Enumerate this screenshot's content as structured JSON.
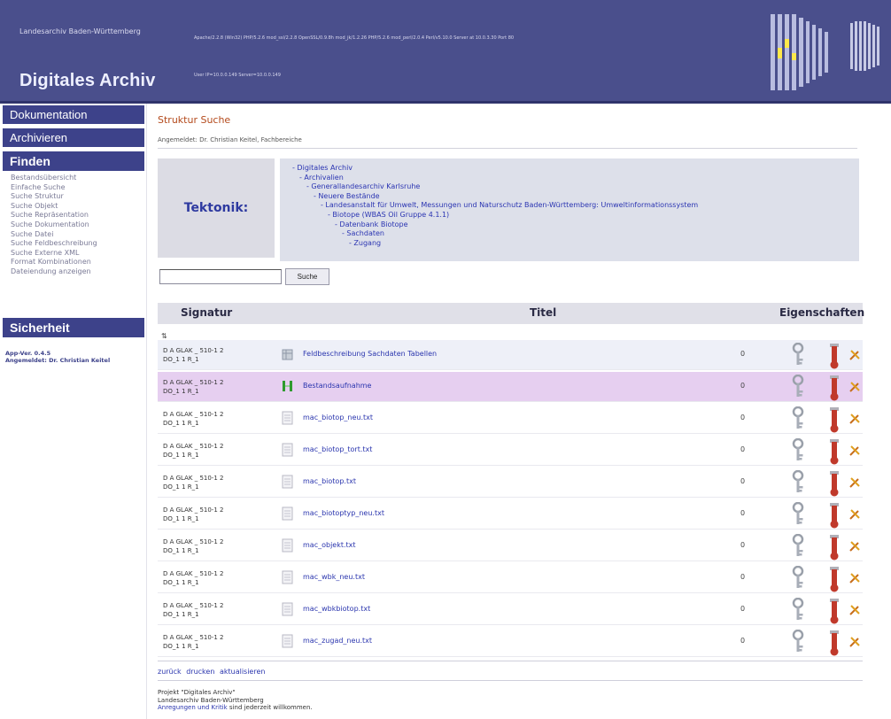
{
  "header": {
    "org_name": "Landesarchiv Baden-Württemberg",
    "app_title": "Digitales Archiv",
    "server_info": "Apache/2.2.8 (Win32) PHP/5.2.6 mod_ssl/2.2.8 OpenSSL/0.9.8h mod_jk/1.2.26 PHP/5.2.6 mod_perl/2.0.4 Perl/v5.10.0 Server at 10.0.3.30 Port 80",
    "server_ip": "User IP=10.0.0.149  Server=10.0.0.149"
  },
  "sidebar": {
    "doc": "Dokumentation",
    "archive": "Archivieren",
    "find": "Finden",
    "sub_items": [
      "Bestandsübersicht",
      "Einfache Suche",
      "Suche Struktur",
      "Suche Objekt",
      "Suche Repräsentation",
      "Suche Dokumentation",
      "Suche Datei",
      "Suche Feldbeschreibung",
      "Suche Externe XML",
      "Format Kombinationen",
      "Dateiendung anzeigen"
    ],
    "security": "Sicherheit",
    "app_version": "App-Ver. 0.4.5",
    "user": "Angemeldet: Dr. Christian Keitel"
  },
  "main": {
    "page_title": "Struktur Suche",
    "logged_user": "Angemeldet: Dr. Christian Keitel, Fachbereiche",
    "tektonik_label": "Tektonik:",
    "tree": [
      "- Digitales Archiv",
      "- Archivalien",
      "- Generallandesarchiv Karlsruhe",
      "- Neuere Bestände",
      "- Landesanstalt für Umwelt, Messungen und Naturschutz Baden-Württemberg: Umweltinformationssystem",
      "- Biotope (WBAS Oil Gruppe 4.1.1)",
      "- Datenbank Biotope",
      "- Sachdaten",
      "- Zugang"
    ],
    "search_value": "",
    "search_button": "Suche"
  },
  "table": {
    "headers": {
      "signature": "Signatur",
      "title": "Titel",
      "properties": "Eigenschaften"
    },
    "sort_symbol": "⇅",
    "rows": [
      {
        "sig1": "D A GLAK _ 510-1 2",
        "sig2": "DO_1 1 R_1",
        "title": "Feldbeschreibung Sachdaten Tabellen",
        "num": "0"
      },
      {
        "sig1": "D A GLAK _ 510-1 2",
        "sig2": "DO_1 1 R_1",
        "title": "Bestandsaufnahme",
        "num": "0"
      },
      {
        "sig1": "D A GLAK _ 510-1 2",
        "sig2": "DO_1 1 R_1",
        "title": "mac_biotop_neu.txt",
        "num": "0"
      },
      {
        "sig1": "D A GLAK _ 510-1 2",
        "sig2": "DO_1 1 R_1",
        "title": "mac_biotop_tort.txt",
        "num": "0"
      },
      {
        "sig1": "D A GLAK _ 510-1 2",
        "sig2": "DO_1 1 R_1",
        "title": "mac_biotop.txt",
        "num": "0"
      },
      {
        "sig1": "D A GLAK _ 510-1 2",
        "sig2": "DO_1 1 R_1",
        "title": "mac_biotoptyp_neu.txt",
        "num": "0"
      },
      {
        "sig1": "D A GLAK _ 510-1 2",
        "sig2": "DO_1 1 R_1",
        "title": "mac_objekt.txt",
        "num": "0"
      },
      {
        "sig1": "D A GLAK _ 510-1 2",
        "sig2": "DO_1 1 R_1",
        "title": "mac_wbk_neu.txt",
        "num": "0"
      },
      {
        "sig1": "D A GLAK _ 510-1 2",
        "sig2": "DO_1 1 R_1",
        "title": "mac_wbkbiotop.txt",
        "num": "0"
      },
      {
        "sig1": "D A GLAK _ 510-1 2",
        "sig2": "DO_1 1 R_1",
        "title": "mac_zugad_neu.txt",
        "num": "0"
      }
    ],
    "back_links": [
      "zurück",
      "drucken",
      "aktualisieren"
    ]
  },
  "footer": {
    "line1": "Projekt \"Digitales Archiv\"",
    "line2": "Landesarchiv Baden-Württemberg",
    "line3_link": "Anregungen und Kritik",
    "line3_rest": " sind jederzeit willkommen."
  },
  "colors": {
    "header_bg": "#4a4f8c",
    "nav_bg": "#3d428a",
    "title_orange": "#b44a1c",
    "link_blue": "#2a35ae",
    "row_selected": "#e6cff0"
  }
}
